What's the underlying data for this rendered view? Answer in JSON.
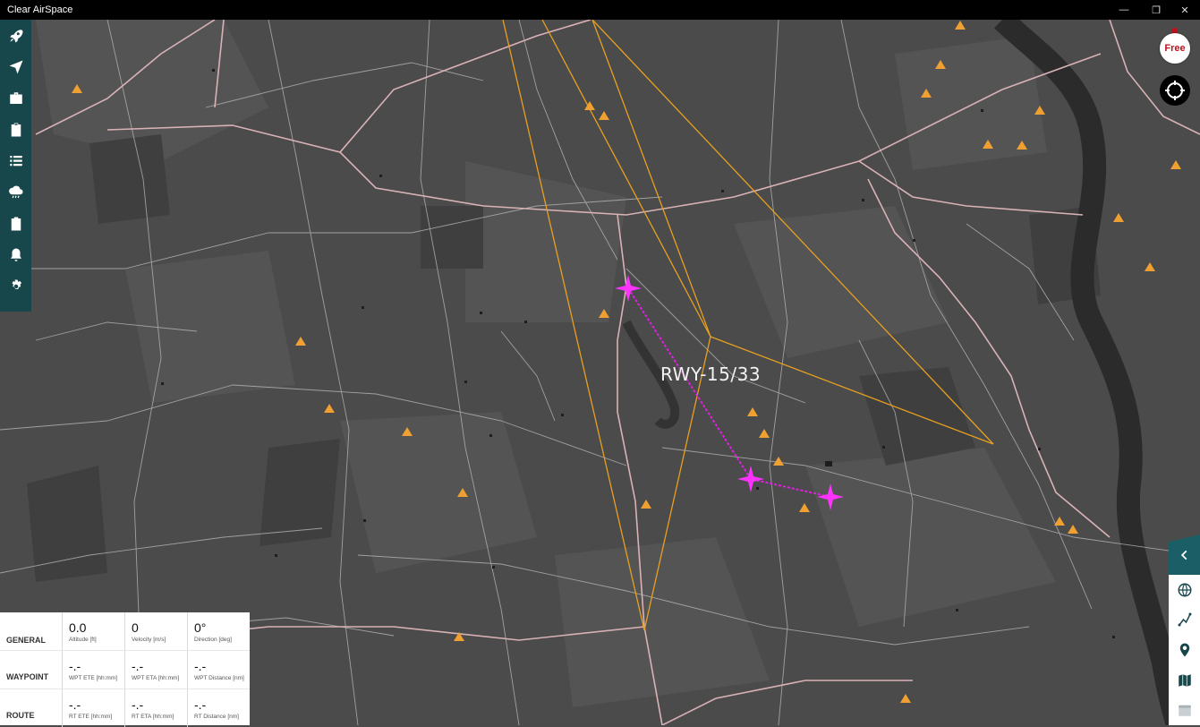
{
  "window": {
    "title": "Clear AirSpace",
    "minimize": "—",
    "restore": "❐",
    "close": "✕"
  },
  "map": {
    "runway_label": "RWY-15/33",
    "flight_path_color": "#e020e0",
    "airspace_color": "#e8a020",
    "marker_color": "#f0a030"
  },
  "sidebar": {
    "items": [
      {
        "icon": "rocket-icon",
        "name": "launch"
      },
      {
        "icon": "navigation-arrow-icon",
        "name": "navigate"
      },
      {
        "icon": "briefcase-icon",
        "name": "equipment"
      },
      {
        "icon": "clipboard-icon",
        "name": "checklist"
      },
      {
        "icon": "list-icon",
        "name": "list"
      },
      {
        "icon": "weather-icon",
        "name": "weather"
      },
      {
        "icon": "clipboard-check-icon",
        "name": "logbook"
      },
      {
        "icon": "bell-icon",
        "name": "alerts"
      },
      {
        "icon": "gear-icon",
        "name": "settings"
      }
    ]
  },
  "top_right": {
    "free_label": "Free",
    "locate_icon": "crosshair-icon"
  },
  "right_tools": {
    "collapse_icon": "chevron-left-icon",
    "items": [
      {
        "icon": "globe-icon",
        "name": "globe"
      },
      {
        "icon": "route-icon",
        "name": "route"
      },
      {
        "icon": "map-pin-icon",
        "name": "pin"
      },
      {
        "icon": "map-icon",
        "name": "map"
      },
      {
        "icon": "calendar-icon",
        "name": "calendar"
      }
    ]
  },
  "info_panel": {
    "general": {
      "label": "GENERAL",
      "cells": [
        {
          "value": "0.0",
          "caption": "Altitude [ft]"
        },
        {
          "value": "0",
          "caption": "Velocity [m/s]"
        },
        {
          "value": "0°",
          "caption": "Direction [deg]"
        }
      ]
    },
    "waypoint": {
      "label": "WAYPOINT",
      "cells": [
        {
          "value": "-.-",
          "caption": "WPT ETE [hh:mm]"
        },
        {
          "value": "-.-",
          "caption": "WPT ETA [hh:mm]"
        },
        {
          "value": "-.-",
          "caption": "WPT Distance [nm]"
        }
      ]
    },
    "route": {
      "label": "ROUTE",
      "cells": [
        {
          "value": "-.-",
          "caption": "RT ETE [hh:mm]"
        },
        {
          "value": "-.-",
          "caption": "RT ETA [hh:mm]"
        },
        {
          "value": "-.-",
          "caption": "RT Distance [nm]"
        }
      ]
    }
  }
}
